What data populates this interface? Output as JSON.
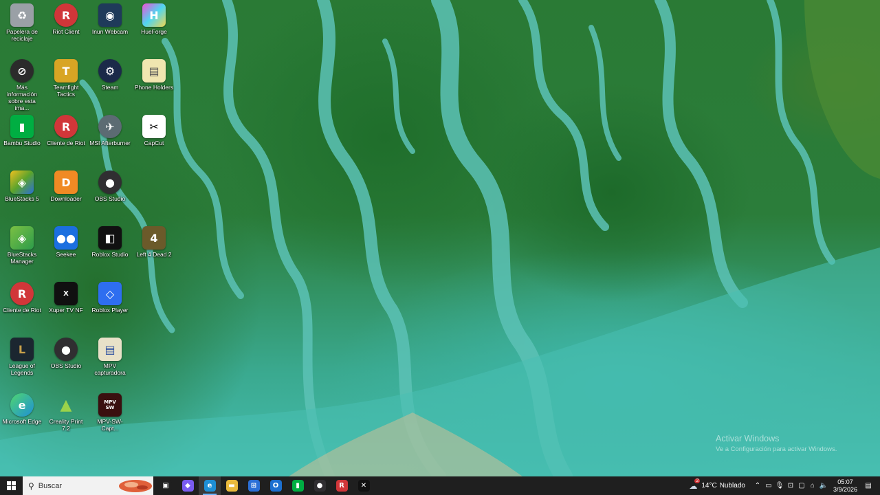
{
  "desktop": {
    "icons": [
      {
        "label": "Papelera de reciclaje",
        "icon": "recycle-bin-icon",
        "color": "#9aa0a6"
      },
      {
        "label": "Riot Client",
        "icon": "riot-client-icon",
        "color": "#d13639"
      },
      {
        "label": "Inun Webcam",
        "icon": "webcam-icon",
        "color": "#1f3a5a"
      },
      {
        "label": "HueForge",
        "icon": "hueforge-icon",
        "color": "#7a4fd6"
      },
      {
        "label": "Más información sobre esta ima...",
        "icon": "info-icon",
        "color": "#2b2b2b"
      },
      {
        "label": "Teamfight Tactics",
        "icon": "tft-icon",
        "color": "#d8a524"
      },
      {
        "label": "Steam",
        "icon": "steam-icon",
        "color": "#1b2a49"
      },
      {
        "label": "Phone Holders",
        "icon": "file-icon",
        "color": "#f0e6b0"
      },
      {
        "label": "Bambu Studio",
        "icon": "bambu-icon",
        "color": "#00ae42"
      },
      {
        "label": "Cliente de Riot",
        "icon": "riot-client-icon",
        "color": "#d13639"
      },
      {
        "label": "MSI Afterburner",
        "icon": "msi-afterburner-icon",
        "color": "#5c6b73"
      },
      {
        "label": "CapCut",
        "icon": "capcut-icon",
        "color": "#111111"
      },
      {
        "label": "BlueStacks 5",
        "icon": "bluestacks-icon",
        "color": "#5aa32c"
      },
      {
        "label": "Downloader",
        "icon": "downloader-icon",
        "color": "#f08a24"
      },
      {
        "label": "OBS Studio",
        "icon": "obs-icon",
        "color": "#302e31"
      },
      {
        "label": "",
        "icon": "",
        "color": ""
      },
      {
        "label": "BlueStacks Manager",
        "icon": "bluestacks-manager-icon",
        "color": "#7bc043"
      },
      {
        "label": "Seekee",
        "icon": "seekee-icon",
        "color": "#1b6fe0"
      },
      {
        "label": "Roblox Studio",
        "icon": "roblox-studio-icon",
        "color": "#111111"
      },
      {
        "label": "Left 4 Dead 2",
        "icon": "left4dead2-icon",
        "color": "#6b5a2a"
      },
      {
        "label": "Cliente de Riot",
        "icon": "riot-client-icon",
        "color": "#d13639"
      },
      {
        "label": "Xuper TV NF",
        "icon": "xupertv-icon",
        "color": "#101010"
      },
      {
        "label": "Roblox Player",
        "icon": "roblox-player-icon",
        "color": "#2e6ef0"
      },
      {
        "label": "",
        "icon": "",
        "color": ""
      },
      {
        "label": "League of Legends",
        "icon": "league-of-legends-icon",
        "color": "#1b2630"
      },
      {
        "label": "OBS Studio",
        "icon": "obs-icon",
        "color": "#302e31"
      },
      {
        "label": "MPV capturadora",
        "icon": "mpv-icon",
        "color": "#e8e1c8"
      },
      {
        "label": "",
        "icon": "",
        "color": ""
      },
      {
        "label": "Microsoft Edge",
        "icon": "edge-icon",
        "color": "#1e8fd6"
      },
      {
        "label": "Creality Print 7.2",
        "icon": "creality-print-icon",
        "color": "#2d9c4a"
      },
      {
        "label": "MPV-SW-Capt...",
        "icon": "mpv-sw-capture-icon",
        "color": "#3a0f0f"
      }
    ],
    "watermark": {
      "title": "Activar Windows",
      "subtitle": "Ve a Configuración para activar Windows."
    }
  },
  "taskbar": {
    "search_placeholder": "Buscar",
    "apps": [
      {
        "name": "task-view-icon",
        "glyph": "▣",
        "color": "#1f1f1f"
      },
      {
        "name": "copilot-icon",
        "glyph": "◆",
        "color": "#7a5cf0"
      },
      {
        "name": "edge-icon",
        "glyph": "e",
        "color": "#1e8fd6",
        "active": true
      },
      {
        "name": "file-explorer-icon",
        "glyph": "▬",
        "color": "#e9b93c"
      },
      {
        "name": "microsoft-store-icon",
        "glyph": "⊞",
        "color": "#2b6fd6"
      },
      {
        "name": "outlook-icon",
        "glyph": "O",
        "color": "#1c6fd0"
      },
      {
        "name": "bambu-studio-icon",
        "glyph": "▮",
        "color": "#00ae42"
      },
      {
        "name": "obs-icon",
        "glyph": "●",
        "color": "#302e31"
      },
      {
        "name": "riot-client-icon",
        "glyph": "R",
        "color": "#d13639"
      },
      {
        "name": "capcut-icon",
        "glyph": "✕",
        "color": "#111111"
      }
    ],
    "weather": {
      "temp": "14°C",
      "condition": "Nublado",
      "badge": "2"
    },
    "clock": {
      "time": "05:07",
      "date": "3/9/2026"
    }
  }
}
